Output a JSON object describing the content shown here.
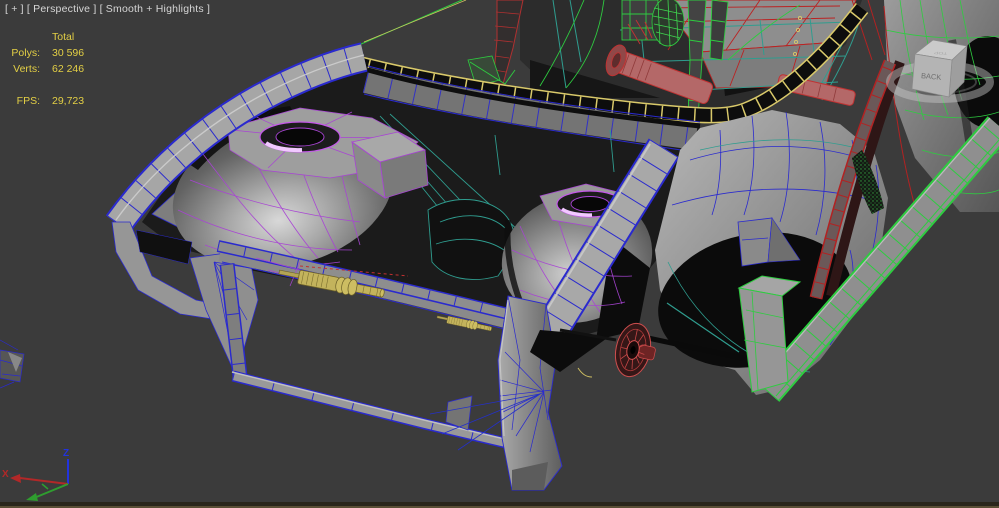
{
  "viewport": {
    "label": "[ + ] [ Perspective ] [ Smooth + Highlights ]",
    "background_color": "#3b3b3b"
  },
  "statistics": {
    "header": "Total",
    "polys_label": "Polys:",
    "polys_value": "30 596",
    "verts_label": "Verts:",
    "verts_value": "62 246",
    "fps_label": "FPS:",
    "fps_value": "29,723",
    "text_color": "#e3cf45"
  },
  "viewcube": {
    "front_face_label": "BACK",
    "top_face_label": "TOP"
  },
  "axis_gizmo": {
    "x_label": "X",
    "z_label": "Z",
    "x_color": "#b22828",
    "y_color": "#2f9d2f",
    "z_color": "#2233dd"
  },
  "model_colors": {
    "body_wire_blue": "#2a2ace",
    "strut_wire_purple": "#a844d4",
    "brace_wire_teal": "#2f9d8f",
    "cage_wire_green": "#2ecc40",
    "floor_wire_red": "#bb2222",
    "cowl_wire_yellow": "#d9c96a",
    "rack_tan": "#c3b35c",
    "hub_red": "#d05050"
  }
}
